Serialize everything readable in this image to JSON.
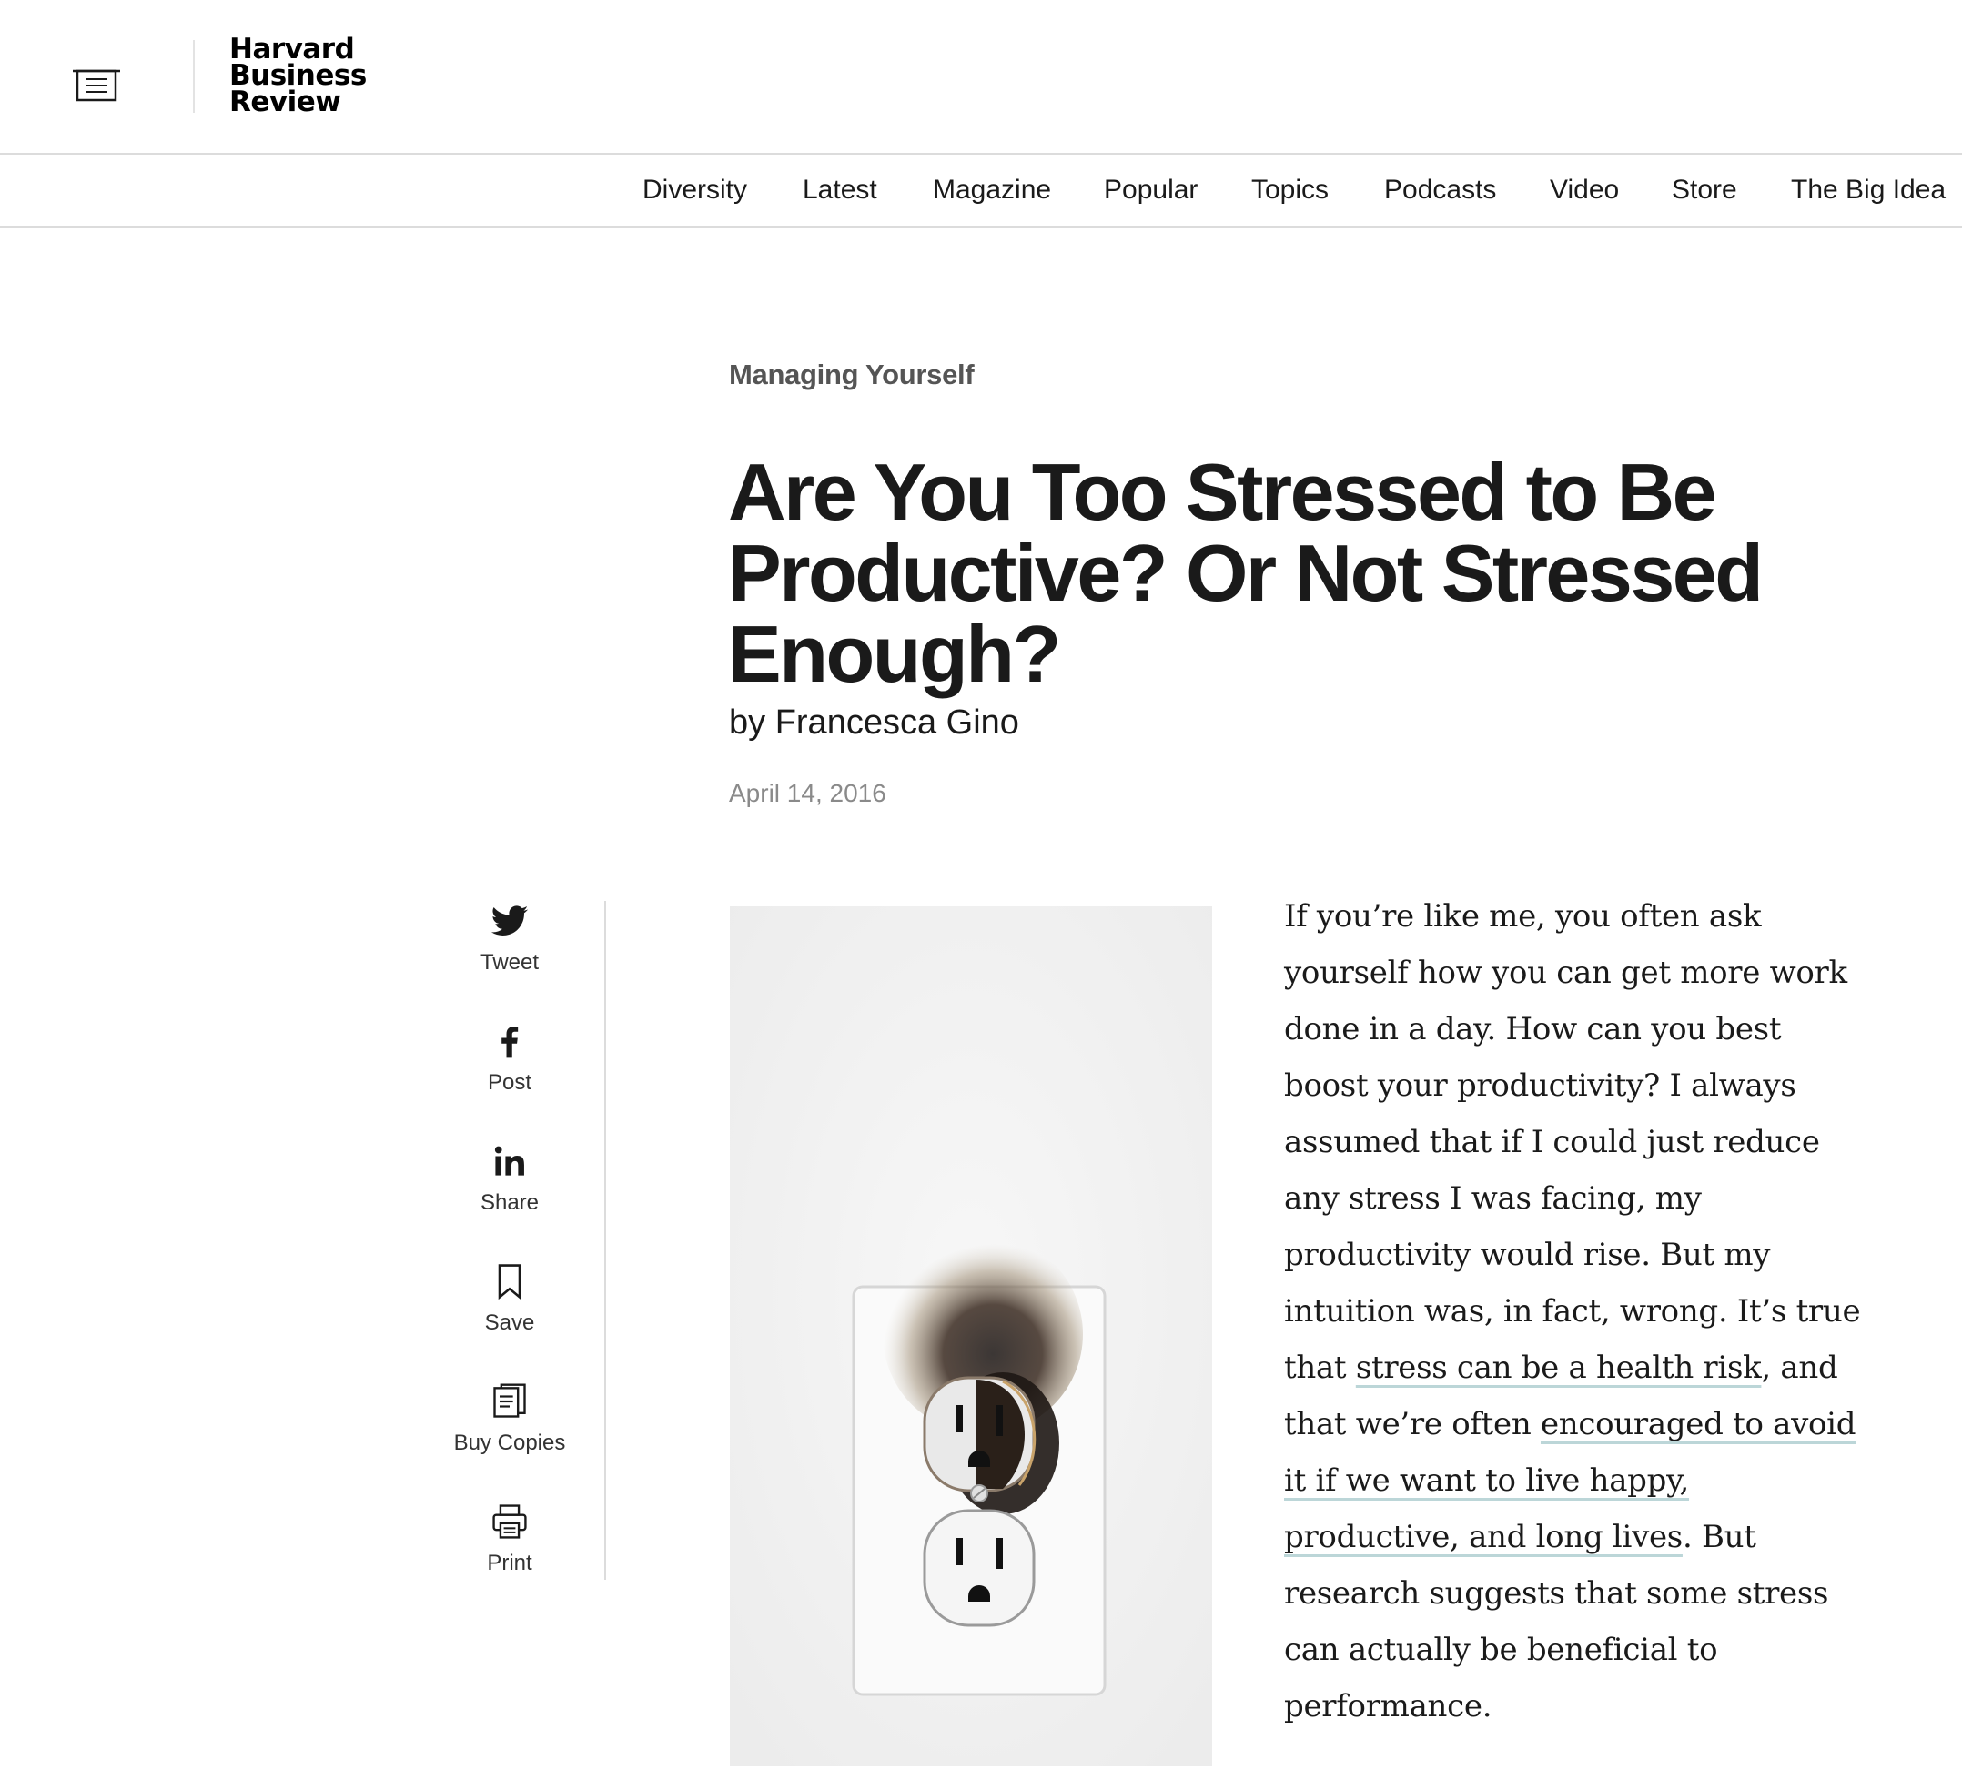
{
  "header": {
    "logo_lines": [
      "Harvard",
      "Business",
      "Review"
    ]
  },
  "nav": {
    "items": [
      "Diversity",
      "Latest",
      "Magazine",
      "Popular",
      "Topics",
      "Podcasts",
      "Video",
      "Store",
      "The Big Idea"
    ]
  },
  "article": {
    "category": "Managing Yourself",
    "title": "Are You Too Stressed to Be Productive? Or Not Stressed Enough?",
    "byline": "by Francesca Gino",
    "date": "April 14, 2016",
    "image_icon": "burnt-electrical-outlet",
    "body": {
      "part1": "If you’re like me, you often ask yourself how you can get more work done in a day. How can you best boost your productivity? I always assumed that if I could just reduce any stress I was facing, my productivity would rise. But my intuition was, in fact, wrong. It’s true that ",
      "link1": "stress can be a health risk",
      "part2": ", and that we’re often ",
      "link2": "encouraged to avoid it if we want to live happy, productive, and long lives",
      "part3": ". But research suggests that some stress can actually be beneficial to performance."
    }
  },
  "share": {
    "tweet": "Tweet",
    "post": "Post",
    "share": "Share",
    "save": "Save",
    "buy_copies": "Buy Copies",
    "print": "Print"
  },
  "colors": {
    "link_underline": "#bcd6d8",
    "category_text": "#555555",
    "date_text": "#8a8a8a",
    "divider": "#dcdcdc"
  }
}
